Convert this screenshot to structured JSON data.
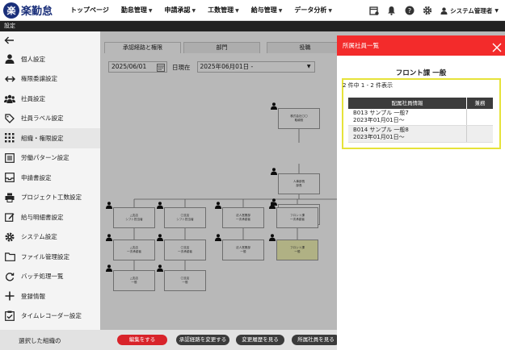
{
  "app": {
    "logo_mark": "楽",
    "logo_text": "楽勤怠"
  },
  "nav": [
    {
      "label": "トップページ",
      "dropdown": false
    },
    {
      "label": "勤怠管理",
      "dropdown": true
    },
    {
      "label": "申請承認",
      "dropdown": true
    },
    {
      "label": "工数管理",
      "dropdown": true
    },
    {
      "label": "給与管理",
      "dropdown": true
    },
    {
      "label": "データ分析",
      "dropdown": true
    }
  ],
  "user": {
    "name": "システム管理者"
  },
  "titlebar": {
    "label": "設定"
  },
  "sidebar": {
    "items": [
      {
        "label": "個人設定",
        "icon": "person-icon"
      },
      {
        "label": "権限委譲設定",
        "icon": "arrows-icon"
      },
      {
        "label": "社員設定",
        "icon": "group-icon"
      },
      {
        "label": "社員ラベル設定",
        "icon": "tag-icon"
      },
      {
        "label": "組織・権限設定",
        "icon": "grid-icon",
        "active": true
      },
      {
        "label": "労働パターン設定",
        "icon": "list-icon"
      },
      {
        "label": "申請書設定",
        "icon": "inbox-icon"
      },
      {
        "label": "プロジェクト工数設定",
        "icon": "printer-icon"
      },
      {
        "label": "給与明細書設定",
        "icon": "edit-icon"
      },
      {
        "label": "システム設定",
        "icon": "gear-icon"
      },
      {
        "label": "ファイル管理設定",
        "icon": "folder-icon"
      },
      {
        "label": "バッチ処理一覧",
        "icon": "refresh-icon"
      },
      {
        "label": "登録情報",
        "icon": "plus-icon"
      },
      {
        "label": "タイムレコーダー設定",
        "icon": "clipboard-icon"
      }
    ]
  },
  "main": {
    "tabs": [
      {
        "label": "承認経路と権限",
        "active": true
      },
      {
        "label": "部門",
        "active": false
      },
      {
        "label": "役職",
        "active": false
      }
    ],
    "date_value": "2025/06/01",
    "asof_label": "日現在",
    "period_value": "2025年06月01日 -",
    "nodes": [
      {
        "lines": [
          "株式会社〇〇",
          "取締役"
        ],
        "highlight": false
      },
      {
        "lines": [
          "人事部長",
          "部長"
        ],
        "highlight": false
      },
      {
        "lines": [
          "株式会社〇〇",
          "経理事務"
        ],
        "highlight": false
      },
      {
        "lines": [
          "△支店",
          "シフト担当者"
        ],
        "highlight": false
      },
      {
        "lines": [
          "〇支店",
          "シフト担当者"
        ],
        "highlight": false
      },
      {
        "lines": [
          "法人営業部",
          "一次承認者"
        ],
        "highlight": false
      },
      {
        "lines": [
          "フロント課",
          "一次承認者"
        ],
        "highlight": false
      },
      {
        "lines": [
          "△支店",
          "一次承認者"
        ],
        "highlight": false
      },
      {
        "lines": [
          "〇支店",
          "一次承認者"
        ],
        "highlight": false
      },
      {
        "lines": [
          "法人営業部",
          "一般"
        ],
        "highlight": false
      },
      {
        "lines": [
          "フロント課",
          "一般"
        ],
        "highlight": true
      },
      {
        "lines": [
          "△支店",
          "一般"
        ],
        "highlight": false
      },
      {
        "lines": [
          "〇支店",
          "一般"
        ],
        "highlight": false
      }
    ]
  },
  "bottombar": {
    "label": "選択した組織の",
    "buttons": [
      {
        "label": "編集をする",
        "style": "red"
      },
      {
        "label": "承認経路を変更する",
        "style": "dark"
      },
      {
        "label": "変更履歴を見る",
        "style": "dark"
      },
      {
        "label": "所属社員を見る",
        "style": "dark"
      }
    ]
  },
  "panel": {
    "header": "所属社員一覧",
    "title": "フロント課 一般",
    "count": "2 件中 1 - 2 件表示",
    "columns": [
      "配属社員情報",
      "兼務"
    ],
    "rows": [
      {
        "line1": "B013 サンプル 一般7",
        "line2": "2023年01月01日〜",
        "kenmu": ""
      },
      {
        "line1": "B014 サンプル 一般8",
        "line2": "2023年01月01日〜",
        "kenmu": ""
      }
    ]
  },
  "colors": {
    "accent_red": "#f32b2b",
    "highlight_yellow": "#e6e33a",
    "brand_navy": "#1a2f7a"
  }
}
